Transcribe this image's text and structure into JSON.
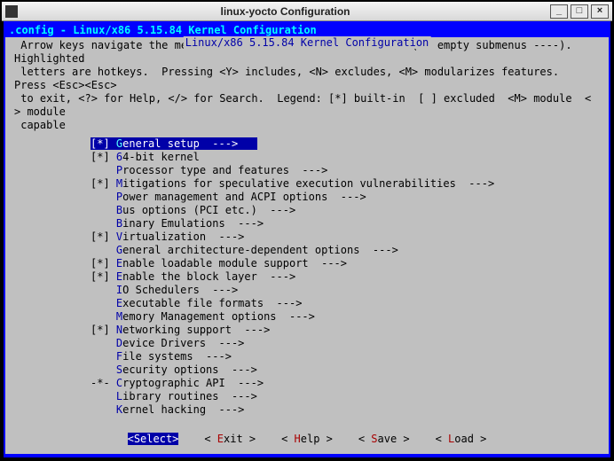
{
  "window": {
    "title": "linux-yocto Configuration",
    "minimize": "_",
    "maximize": "□",
    "close": "×"
  },
  "config_header": ".config - Linux/x86 5.15.84 Kernel Configuration",
  "panel_title": " Linux/x86 5.15.84 Kernel Configuration ",
  "help_lines": " Arrow keys navigate the menu.  <Enter> selects submenus ---> (or empty submenus ----).  Highlighted\n letters are hotkeys.  Pressing <Y> includes, <N> excludes, <M> modularizes features.  Press <Esc><Esc>\n to exit, <?> for Help, </> for Search.  Legend: [*] built-in  [ ] excluded  <M> module  < > module\n capable",
  "menu": [
    {
      "prefix": "    ",
      "hot": "G",
      "rest": "eneral setup  --->",
      "selected": true,
      "state": "[*]"
    },
    {
      "prefix": "[*] ",
      "hot": "6",
      "rest": "4-bit kernel"
    },
    {
      "prefix": "    ",
      "hot": "P",
      "rest": "rocessor type and features  --->"
    },
    {
      "prefix": "[*] ",
      "hot": "M",
      "rest": "itigations for speculative execution vulnerabilities  --->"
    },
    {
      "prefix": "    ",
      "hot": "P",
      "rest": "ower management and ACPI options  --->"
    },
    {
      "prefix": "    ",
      "hot": "B",
      "rest": "us options (PCI etc.)  --->"
    },
    {
      "prefix": "    ",
      "hot": "B",
      "rest": "inary Emulations  --->"
    },
    {
      "prefix": "[*] ",
      "hot": "V",
      "rest": "irtualization  --->"
    },
    {
      "prefix": "    ",
      "hot": "G",
      "rest": "eneral architecture-dependent options  --->"
    },
    {
      "prefix": "[*] ",
      "hot": "E",
      "rest": "nable loadable module support  --->"
    },
    {
      "prefix": "[*] ",
      "hot": "E",
      "rest": "nable the block layer  --->"
    },
    {
      "prefix": "    ",
      "hot": "I",
      "rest": "O Schedulers  --->"
    },
    {
      "prefix": "    ",
      "hot": "E",
      "rest": "xecutable file formats  --->"
    },
    {
      "prefix": "    ",
      "hot": "M",
      "rest": "emory Management options  --->"
    },
    {
      "prefix": "[*] ",
      "hot": "N",
      "rest": "etworking support  --->"
    },
    {
      "prefix": "    ",
      "hot": "D",
      "rest": "evice Drivers  --->"
    },
    {
      "prefix": "    ",
      "hot": "F",
      "rest": "ile systems  --->"
    },
    {
      "prefix": "    ",
      "hot": "S",
      "rest": "ecurity options  --->"
    },
    {
      "prefix": "-*- ",
      "hot": "C",
      "rest": "ryptographic API  --->"
    },
    {
      "prefix": "    ",
      "hot": "L",
      "rest": "ibrary routines  --->"
    },
    {
      "prefix": "    ",
      "hot": "K",
      "rest": "ernel hacking  --->"
    }
  ],
  "buttons": [
    {
      "label": "Select",
      "hot": "S",
      "selected": true
    },
    {
      "label": "Exit",
      "hot": "E"
    },
    {
      "label": "Help",
      "hot": "H"
    },
    {
      "label": "Save",
      "hot": "S"
    },
    {
      "label": "Load",
      "hot": "L"
    }
  ]
}
